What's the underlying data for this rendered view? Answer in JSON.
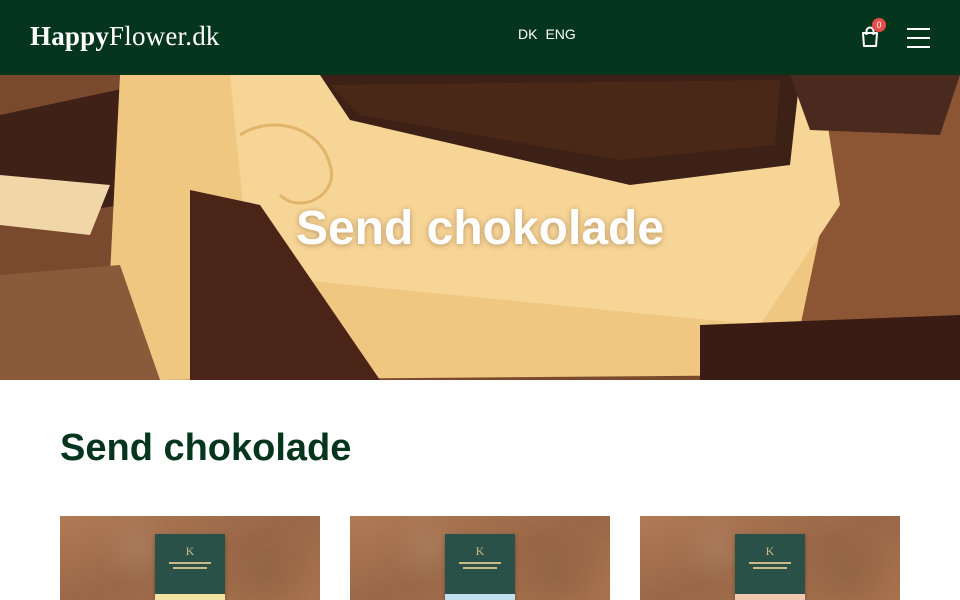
{
  "header": {
    "logo_bold": "Happy",
    "logo_rest": "Flower.dk",
    "lang_dk": "DK",
    "lang_eng": "ENG",
    "cart_count": "0",
    "cart_icon": "shopping-bag-icon",
    "menu_icon": "hamburger-menu-icon"
  },
  "hero": {
    "title": "Send chokolade"
  },
  "main": {
    "title": "Send chokolade"
  },
  "products": [
    {
      "box_letter": "K",
      "stripe_color": "#f3e3a0"
    },
    {
      "box_letter": "K",
      "stripe_color": "#bfe0ee"
    },
    {
      "box_letter": "K",
      "stripe_color": "#f2c8b0"
    }
  ],
  "colors": {
    "header_bg": "#06351e",
    "title_green": "#06351e",
    "badge_red": "#e84b4b"
  }
}
